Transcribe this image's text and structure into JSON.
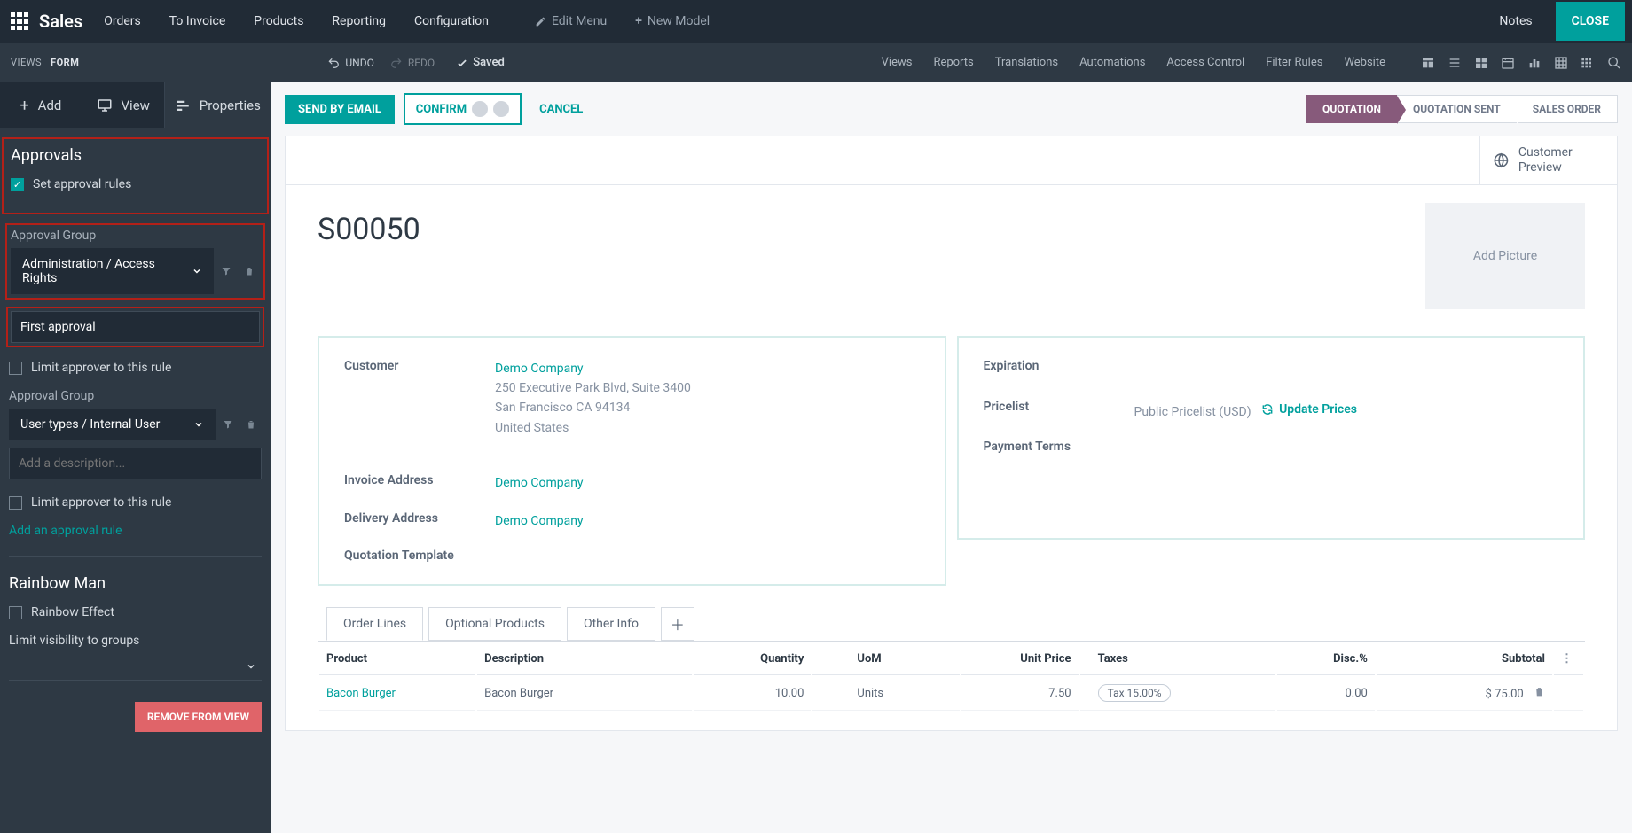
{
  "topbar": {
    "brand": "Sales",
    "menu": [
      "Orders",
      "To Invoice",
      "Products",
      "Reporting",
      "Configuration"
    ],
    "edit_menu": "Edit Menu",
    "new_model": "New Model",
    "notes": "Notes",
    "close": "CLOSE"
  },
  "toolbar2": {
    "crumbs": [
      "VIEWS",
      "FORM"
    ],
    "undo": "UNDO",
    "redo": "REDO",
    "saved": "Saved",
    "center_menu": [
      "Views",
      "Reports",
      "Translations",
      "Automations",
      "Access Control",
      "Filter Rules",
      "Website"
    ]
  },
  "sidebar": {
    "tabs": {
      "add": "Add",
      "view": "View",
      "properties": "Properties"
    },
    "approvals": {
      "title": "Approvals",
      "set_rules": "Set approval rules",
      "group_label": "Approval Group",
      "group1_value": "Administration / Access Rights",
      "desc1_value": "First approval",
      "limit_label": "Limit approver to this rule",
      "group2_value": "User types / Internal User",
      "desc2_placeholder": "Add a description...",
      "add_rule": "Add an approval rule"
    },
    "rainbow": {
      "title": "Rainbow Man",
      "effect": "Rainbow Effect",
      "limit_vis": "Limit visibility to groups"
    },
    "remove": "REMOVE FROM VIEW"
  },
  "actions": {
    "send_email": "SEND BY EMAIL",
    "confirm": "CONFIRM",
    "cancel": "CANCEL"
  },
  "stages": [
    "QUOTATION",
    "QUOTATION SENT",
    "SALES ORDER"
  ],
  "customer_preview": "Customer Preview",
  "record": {
    "title": "S00050",
    "add_picture": "Add Picture"
  },
  "fields_left": {
    "customer_label": "Customer",
    "customer_name": "Demo Company",
    "customer_addr1": "250 Executive Park Blvd, Suite 3400",
    "customer_addr2": "San Francisco CA 94134",
    "customer_addr3": "United States",
    "invoice_label": "Invoice Address",
    "invoice_val": "Demo Company",
    "delivery_label": "Delivery Address",
    "delivery_val": "Demo Company",
    "template_label": "Quotation Template"
  },
  "fields_right": {
    "expiration_label": "Expiration",
    "pricelist_label": "Pricelist",
    "pricelist_val": "Public Pricelist (USD)",
    "update_prices": "Update Prices",
    "payment_label": "Payment Terms"
  },
  "tabs": [
    "Order Lines",
    "Optional Products",
    "Other Info"
  ],
  "table": {
    "headers": [
      "Product",
      "Description",
      "Quantity",
      "UoM",
      "Unit Price",
      "Taxes",
      "Disc.%",
      "Subtotal"
    ],
    "rows": [
      {
        "product": "Bacon Burger",
        "description": "Bacon Burger",
        "quantity": "10.00",
        "uom": "Units",
        "unit_price": "7.50",
        "tax": "Tax 15.00%",
        "disc": "0.00",
        "subtotal": "$ 75.00"
      }
    ]
  }
}
